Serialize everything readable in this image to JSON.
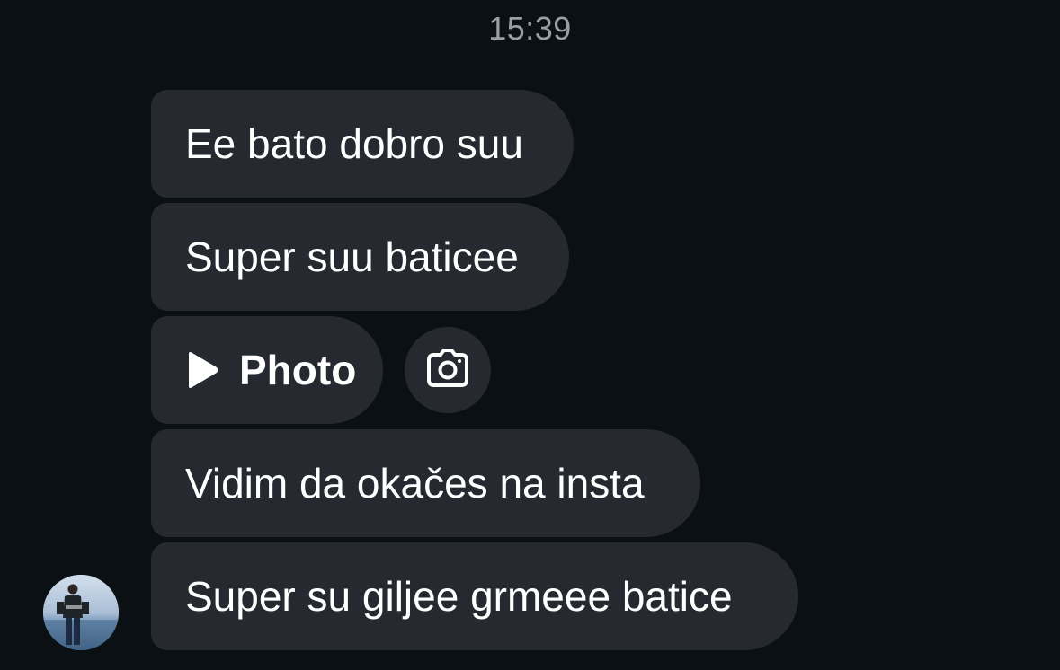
{
  "chat": {
    "timestamp": "15:39",
    "messages": [
      {
        "text": "Ee bato dobro suu"
      },
      {
        "text": "Super suu baticee"
      },
      {
        "type": "photo",
        "text": "Photo",
        "icon": "play-icon",
        "reply_icon": "camera-icon"
      },
      {
        "text": "Vidim da okačes na insta"
      },
      {
        "text": "Super su giljee grmeee batice"
      }
    ],
    "sender_avatar": "avatar"
  },
  "colors": {
    "background": "#0b1014",
    "bubble": "#262a30",
    "text": "#ffffff",
    "timestamp": "#9aa0a6"
  }
}
